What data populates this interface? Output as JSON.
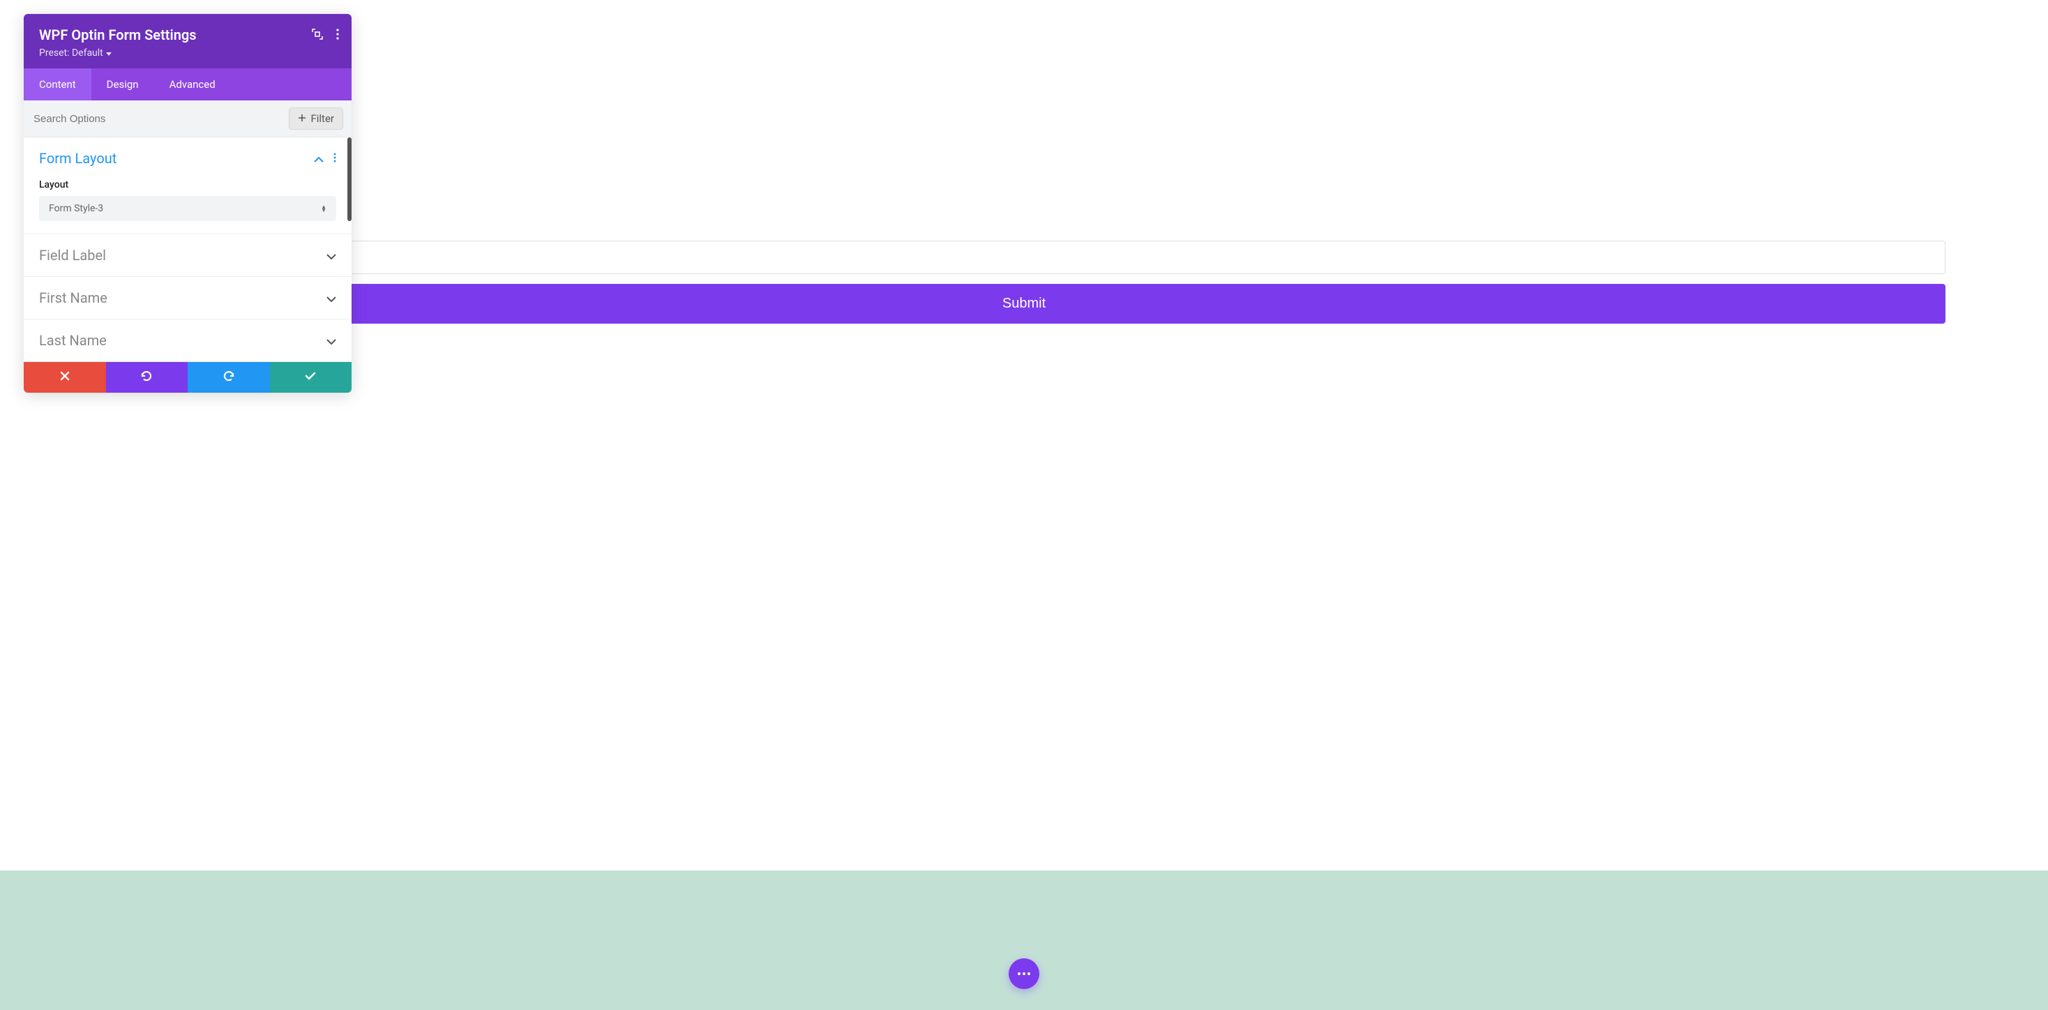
{
  "panel": {
    "title": "WPF Optin Form Settings",
    "preset_label": "Preset: Default"
  },
  "tabs": [
    {
      "label": "Content"
    },
    {
      "label": "Design"
    },
    {
      "label": "Advanced"
    }
  ],
  "search": {
    "placeholder": "Search Options"
  },
  "filter": {
    "label": "Filter"
  },
  "sections": {
    "form_layout": {
      "title": "Form Layout",
      "field_label": "Layout",
      "select_value": "Form Style-3"
    },
    "field_label": {
      "title": "Field Label"
    },
    "first_name": {
      "title": "First Name"
    },
    "last_name": {
      "title": "Last Name"
    }
  },
  "preview": {
    "submit_label": "Submit"
  }
}
